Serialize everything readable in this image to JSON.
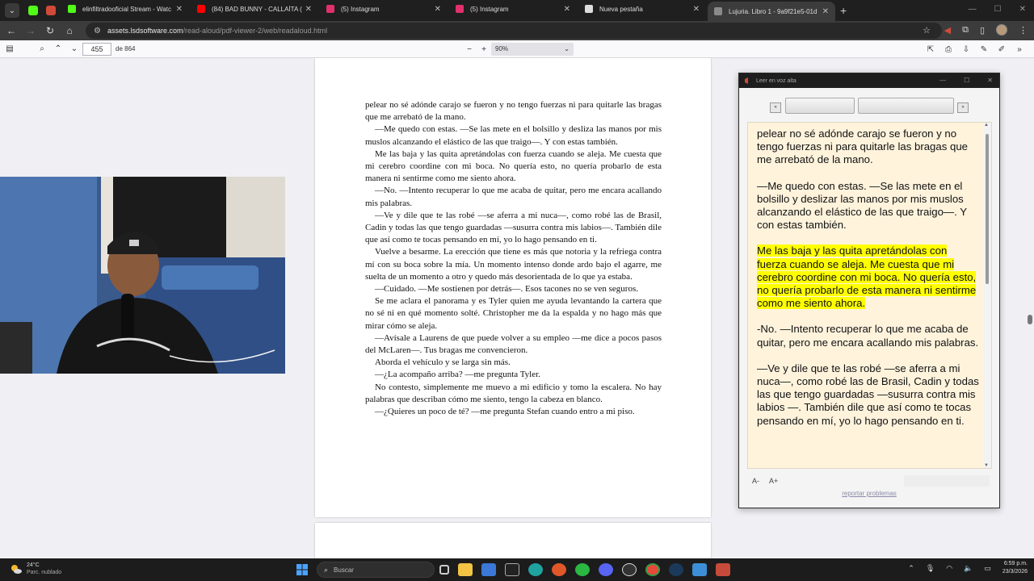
{
  "browser": {
    "tabs": [
      {
        "label": "elinfiltradooficial Stream - Watc",
        "fav": "#53fc18"
      },
      {
        "label": "(84) BAD BUNNY - CALLAÍTA (C",
        "fav": "#ff0000"
      },
      {
        "label": "(5) Instagram",
        "fav": "#e1306c"
      },
      {
        "label": "(5) Instagram",
        "fav": "#e1306c"
      },
      {
        "label": "Nueva pestaña",
        "fav": "#dddddd"
      },
      {
        "label": "Lujuria. Libro 1 - 9a9f21e5-01d",
        "fav": "#8a8a8a"
      }
    ],
    "url_host": "assets.lsdsoftware.com",
    "url_path": "/read-aloud/pdf-viewer-2/web/readaloud.html"
  },
  "pdf_toolbar": {
    "page_number": "455",
    "page_total": "de 864",
    "zoom": "90%"
  },
  "page_paragraphs": [
    "pelear no sé adónde carajo se fueron y no tengo fuerzas ni para quitarle las bragas que me arrebató de la mano.",
    "—Me quedo con estas. —Se las mete en el bolsillo y desliza las manos por mis muslos alcanzando el elástico de las que traigo—. Y con estas también.",
    "Me las baja y las quita apretándolas con fuerza cuando se aleja. Me cuesta que mi cerebro coordine con mi boca. No quería esto, no quería probarlo de esta manera ni sentirme como me siento ahora.",
    "—No. —Intento recuperar lo que me acaba de quitar, pero me encara acallando mis palabras.",
    "—Ve y dile que te las robé —se aferra a mi nuca—, como robé las de Brasil, Cadin y todas las que tengo guardadas —susurra contra mis labios—. También dile que así como te tocas pensando en mí, yo lo hago pensando en ti.",
    "Vuelve a besarme. La erección que tiene es más que notoria y la refriega contra mí con su boca sobre la mía. Un momento intenso donde ardo bajo el agarre, me suelta de un momento a otro y quedo más desorientada de lo que ya estaba.",
    "—Cuidado. —Me sostienen por detrás—. Esos tacones no se ven seguros.",
    "Se me aclara el panorama y es Tyler quien me ayuda levantando la cartera que no sé ni en qué momento solté. Christopher me da la espalda y no hago más que mirar cómo se aleja.",
    "—Avísale a Laurens de que puede volver a su empleo —me dice a pocos pasos del McLaren—. Tus bragas me convencieron.",
    "Aborda el vehículo y se larga sin más.",
    "—¿La acompaño arriba? —me pregunta Tyler.",
    "No contesto, simplemente me muevo a mi edificio y tomo la escalera. No hay palabras que describan cómo me siento, tengo la cabeza en blanco.",
    "—¿Quieres un poco de té? —me pregunta Stefan cuando entro a mi piso."
  ],
  "read_aloud": {
    "title": "Leer en voz alta",
    "paragraphs": [
      {
        "text": "pelear no sé adónde carajo se fueron y no tengo fuerzas ni para quitarle las bragas que me arrebató de la mano.",
        "highlight": false
      },
      {
        "text": "—Me quedo con estas. —Se las mete en el bolsillo y deslizar las manos por mis muslos alcanzando el elástico de las que traigo—. Y con estas también.",
        "highlight": false
      },
      {
        "text": "Me las baja y las quita apretándolas con fuerza cuando se aleja. Me cuesta que mi cerebro coordine con mi boca. No quería esto, no quería probarlo de esta manera ni sentirme como me siento ahora.",
        "highlight": true
      },
      {
        "text": "-No. —Intento recuperar lo que me acaba de quitar, pero me encara acallando mis palabras.",
        "highlight": false
      },
      {
        "text": "—Ve y dile que te las robé —se aferra a mi nuca—, como robé las de Brasil, Cadin y todas las que tengo guardadas —susurra contra mis labios —. También dile que así como te tocas pensando en mí, yo lo hago pensando en ti.",
        "highlight": false
      }
    ],
    "prev_label": "«",
    "next_label": "»",
    "font_minus": "A-",
    "font_plus": "A+",
    "report_link": "reportar problemas",
    "highlight_color": "#ffff00"
  },
  "taskbar": {
    "temp": "24°C",
    "weather": "Parc. nublado",
    "search_placeholder": "Buscar",
    "time": "6:59 p.m.",
    "date": "23/3/2026"
  }
}
